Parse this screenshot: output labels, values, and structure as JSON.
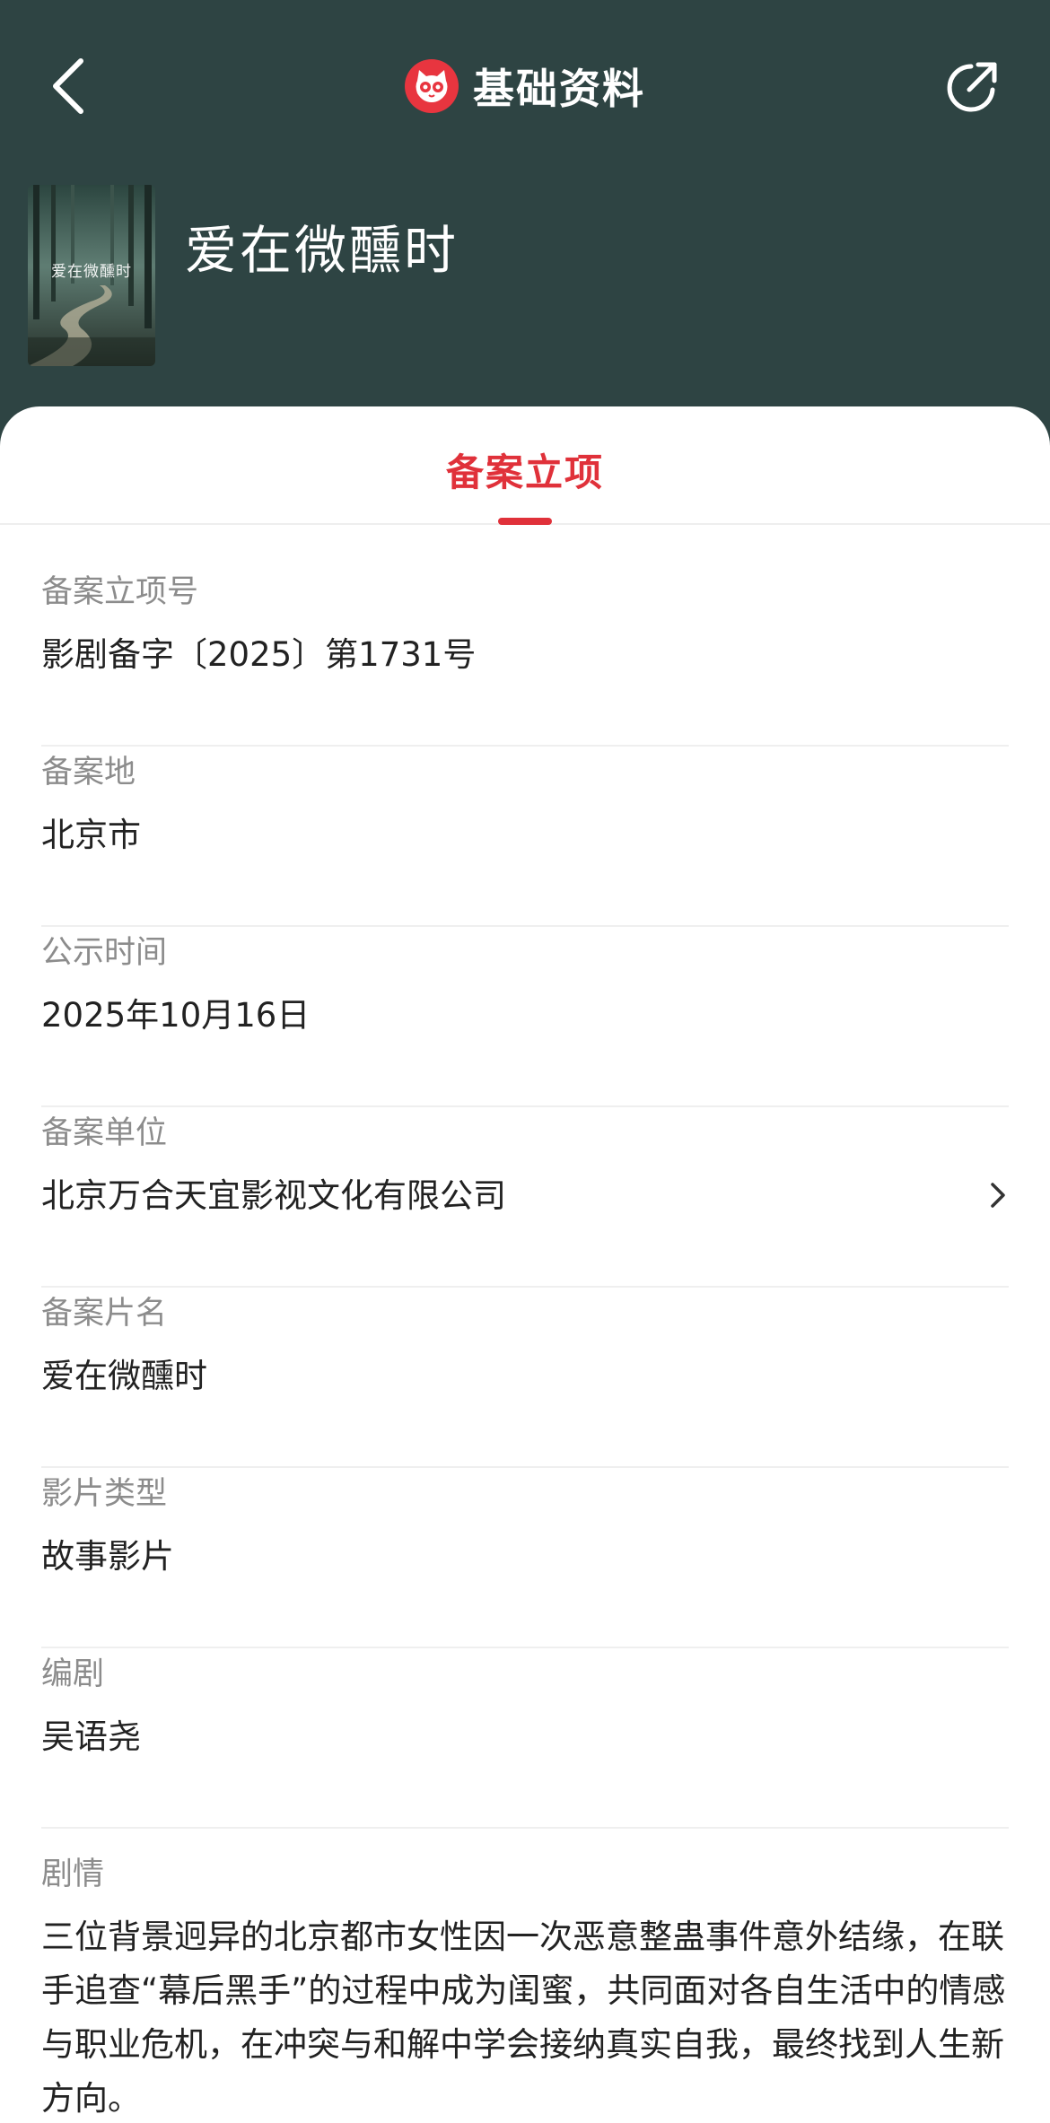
{
  "header": {
    "title": "基础资料",
    "back_icon": "chevron-left-icon",
    "share_icon": "share-icon",
    "logo_icon": "cat-logo-icon",
    "background_color": "#2e4443"
  },
  "movie": {
    "title": "爱在微醺时",
    "poster_text": "爱在微醺时"
  },
  "tabs": {
    "active_label": "备案立项",
    "accent_color": "#e0313a"
  },
  "fields": [
    {
      "label": "备案立项号",
      "value": "影剧备字〔2025〕第1731号"
    },
    {
      "label": "备案地",
      "value": "北京市"
    },
    {
      "label": "公示时间",
      "value": "2025年10月16日"
    },
    {
      "label": "备案单位",
      "value": "北京万合天宜影视文化有限公司"
    },
    {
      "label": "备案片名",
      "value": "爱在微醺时"
    },
    {
      "label": "影片类型",
      "value": "故事影片"
    },
    {
      "label": "编剧",
      "value": "吴语尧"
    }
  ],
  "plot": {
    "label": "剧情",
    "text": "三位背景迥异的北京都市女性因一次恶意整蛊事件意外结缘，在联手追查“幕后黑手”的过程中成为闺蜜，共同面对各自生活中的情感与职业危机，在冲突与和解中学会接纳真实自我，最终找到人生新方向。"
  }
}
